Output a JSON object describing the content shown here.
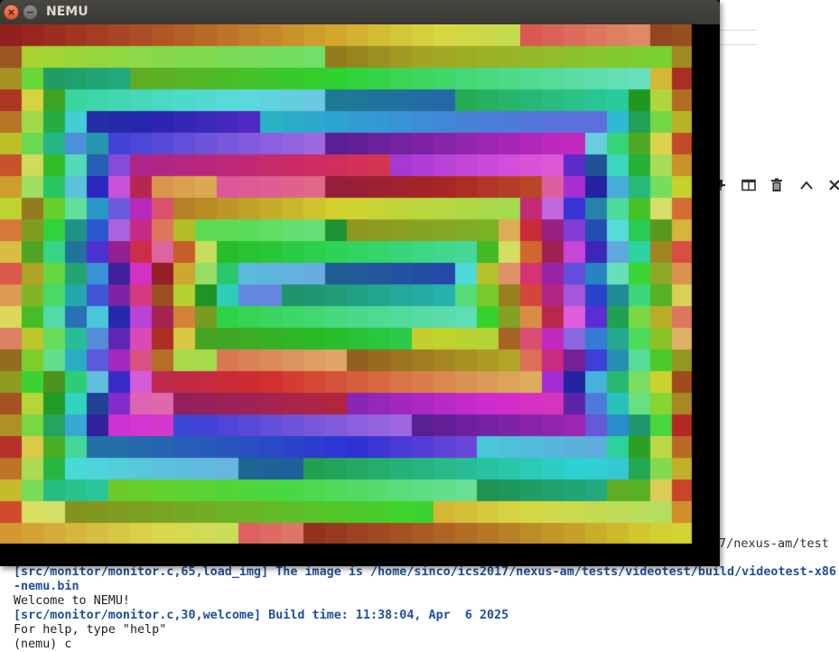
{
  "window": {
    "title": "NEMU",
    "close_glyph": "×",
    "minimize_glyph": "−"
  },
  "background": {
    "path_fragment": "7/nexus-am/test",
    "toolbar_icons": [
      "pin-icon",
      "split-view-icon",
      "trash-icon",
      "chevron-up-icon",
      "close-icon"
    ]
  },
  "terminal": {
    "lines": [
      {
        "kind": "log",
        "text": "[src/monitor/monitor.c,65,load_img] The image is /home/sinco/ics2017/nexus-am/tests/videotest/build/videotest-x86"
      },
      {
        "kind": "log",
        "text": "-nemu.bin"
      },
      {
        "kind": "plain",
        "text": "Welcome to NEMU!"
      },
      {
        "kind": "log",
        "text": "[src/monitor/monitor.c,30,welcome] Build time: 11:38:04, Apr  6 2025"
      },
      {
        "kind": "plain",
        "text": "For help, type \"help\""
      },
      {
        "kind": "plain",
        "text": "(nemu) c"
      }
    ]
  },
  "screen": {
    "description_colors": {
      "background": "#000000",
      "ring_palette_sample": [
        "#e0307f",
        "#2bd4b8",
        "#4a2fd6",
        "#7c8f1c",
        "#76d65a",
        "#a0e0e6",
        "#f3a2b4",
        "#6a5ae6",
        "#1a1a10",
        "#f02a2a",
        "#0d3a30"
      ]
    }
  }
}
